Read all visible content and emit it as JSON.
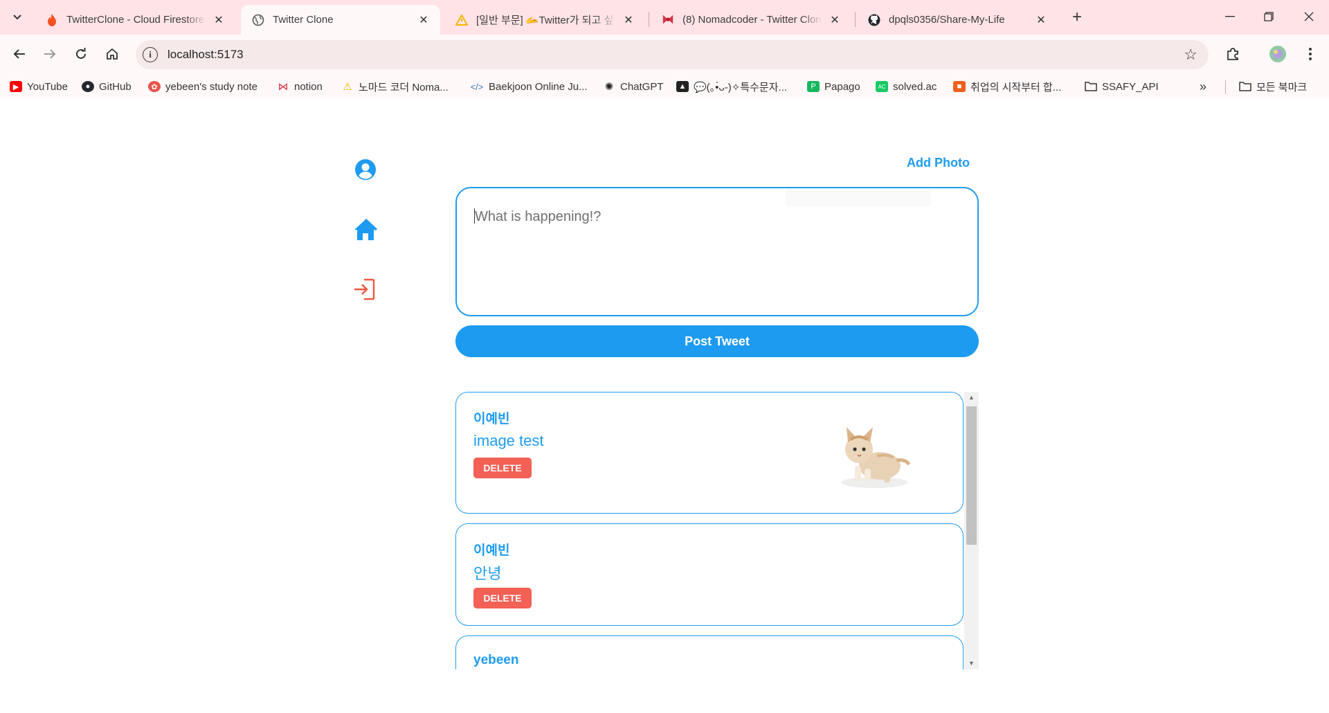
{
  "browser": {
    "tabs": [
      {
        "title": "TwitterClone - Cloud Firestore",
        "icon": "firebase-icon",
        "active": false
      },
      {
        "title": "Twitter Clone",
        "icon": "globe-icon",
        "active": true
      },
      {
        "title": "[일반 부문] 🫴Twitter가 되고 싶",
        "icon": "warning-icon",
        "active": false
      },
      {
        "title": "(8) Nomadcoder - Twitter Clon",
        "icon": "ribbon-icon",
        "active": false
      },
      {
        "title": "dpqls0356/Share-My-Life",
        "icon": "github-icon",
        "active": false
      }
    ],
    "url": "localhost:5173",
    "bookmarks": [
      {
        "label": "YouTube",
        "icon": "youtube-icon",
        "color": "#ff0000"
      },
      {
        "label": "GitHub",
        "icon": "github-icon",
        "color": "#24292f"
      },
      {
        "label": "yebeen's study note",
        "icon": "note-icon",
        "color": "#e9534b"
      },
      {
        "label": "notion",
        "icon": "ribbon-icon",
        "color": "#d63447"
      },
      {
        "label": "노마드 코더 Noma...",
        "icon": "warning-icon",
        "color": "#f2b600"
      },
      {
        "label": "Baekjoon Online Ju...",
        "icon": "code-icon",
        "color": "#3a6fbf"
      },
      {
        "label": "ChatGPT",
        "icon": "openai-icon",
        "color": "#222222"
      },
      {
        "label": "💬(｡•̀ᴗ-)✧특수문자...",
        "icon": "cat-icon",
        "color": "#222222"
      },
      {
        "label": "Papago",
        "icon": "papago-icon",
        "color": "#17b75e"
      },
      {
        "label": "solved.ac",
        "icon": "solved-icon",
        "color": "#17c964"
      },
      {
        "label": "취업의 시작부터 합...",
        "icon": "orange-square-icon",
        "color": "#f0601e"
      },
      {
        "label": "SSAFY_API",
        "icon": "folder-icon",
        "color": "#333333"
      }
    ],
    "bookmarks_more": "»",
    "all_bookmarks": "모든 북마크"
  },
  "app": {
    "add_photo": "Add Photo",
    "placeholder": "What is happening!?",
    "post_button": "Post Tweet",
    "colors": {
      "accent": "#1d9bf0",
      "danger": "#f36055",
      "logout": "#f0563f"
    },
    "tweets": [
      {
        "user": "이예빈",
        "text": "image test",
        "delete": "DELETE",
        "has_photo": true
      },
      {
        "user": "이예빈",
        "text": "안녕",
        "delete": "DELETE",
        "has_photo": false
      },
      {
        "user": "yebeen",
        "text": "",
        "delete": "",
        "has_photo": false
      }
    ]
  }
}
